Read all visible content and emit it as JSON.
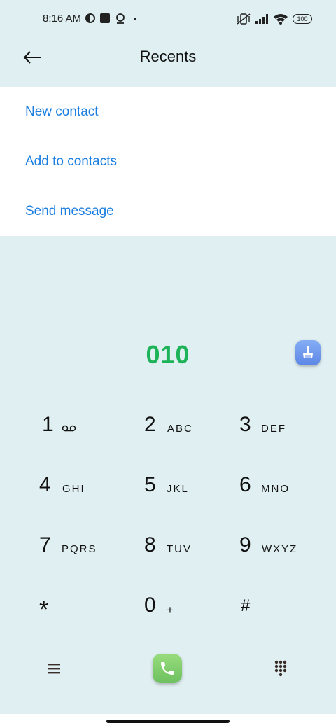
{
  "status_bar": {
    "time": "8:16 AM",
    "battery": "100",
    "left_icons": [
      "data-saver-icon",
      "square-notification-icon",
      "location-icon",
      "dot-icon"
    ],
    "right_icons": [
      "vibrate-off-icon",
      "signal-icon",
      "wifi-icon",
      "battery-icon"
    ]
  },
  "header": {
    "title": "Recents",
    "back_icon": "back-arrow-icon"
  },
  "menu": {
    "items": [
      {
        "label": "New contact"
      },
      {
        "label": "Add to contacts"
      },
      {
        "label": "Send message"
      }
    ]
  },
  "dialer": {
    "number": "010",
    "clear_icon": "broom-icon",
    "keys": [
      {
        "digit": "1",
        "letters": "",
        "icon": "voicemail-icon"
      },
      {
        "digit": "2",
        "letters": "ABC"
      },
      {
        "digit": "3",
        "letters": "DEF"
      },
      {
        "digit": "4",
        "letters": "GHI"
      },
      {
        "digit": "5",
        "letters": "JKL"
      },
      {
        "digit": "6",
        "letters": "MNO"
      },
      {
        "digit": "7",
        "letters": "PQRS"
      },
      {
        "digit": "8",
        "letters": "TUV"
      },
      {
        "digit": "9",
        "letters": "WXYZ"
      },
      {
        "digit": "*",
        "letters": ""
      },
      {
        "digit": "0",
        "letters": "+"
      },
      {
        "digit": "#",
        "letters": ""
      }
    ]
  },
  "bottom_actions": {
    "menu_icon": "hamburger-icon",
    "call_icon": "phone-icon",
    "keypad_icon": "keypad-icon"
  },
  "colors": {
    "accent_blue": "#1a7ee0",
    "number_green": "#1db359",
    "background": "#e0eff1",
    "call_green": "#6ec060",
    "clean_blue": "#5c86e6"
  }
}
